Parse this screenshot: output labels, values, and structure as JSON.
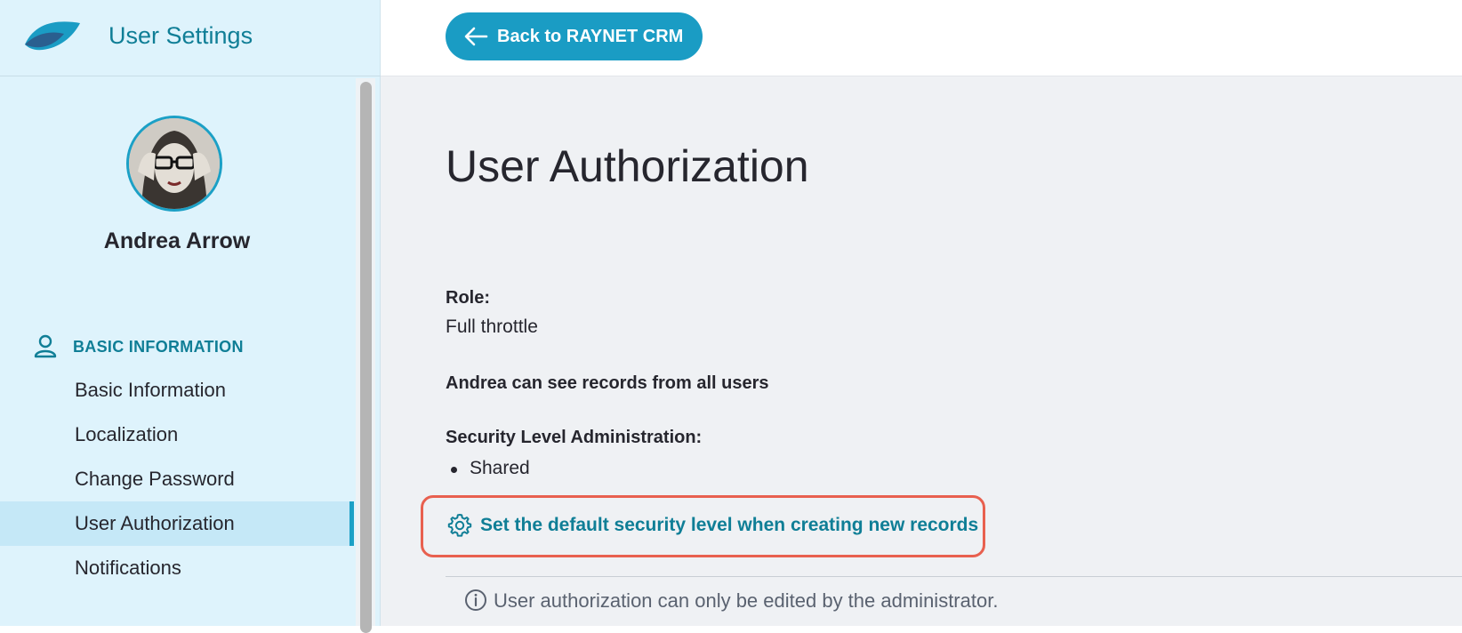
{
  "app": {
    "title": "User Settings",
    "back_button_label": "Back to RAYNET CRM"
  },
  "colors": {
    "accent": "#1a9cc4",
    "brand_text": "#0f7e96",
    "sidebar_bg": "#def3fc",
    "highlight": "#e8604f"
  },
  "user": {
    "name": "Andrea Arrow",
    "avatar_icon": "user-avatar-photo"
  },
  "sidebar": {
    "section_title": "BASIC INFORMATION",
    "section_icon": "person-icon",
    "items": [
      {
        "label": "Basic Information",
        "active": false
      },
      {
        "label": "Localization",
        "active": false
      },
      {
        "label": "Change Password",
        "active": false
      },
      {
        "label": "User Authorization",
        "active": true
      },
      {
        "label": "Notifications",
        "active": false
      }
    ]
  },
  "main": {
    "title": "User Authorization",
    "role_label": "Role:",
    "role_value": "Full throttle",
    "visibility_text": "Andrea can see records from all users",
    "security_label": "Security Level Administration:",
    "security_levels": [
      "Shared"
    ],
    "default_security_link": "Set the default security level when creating new records",
    "info_note": "User authorization can only be edited by the administrator."
  }
}
